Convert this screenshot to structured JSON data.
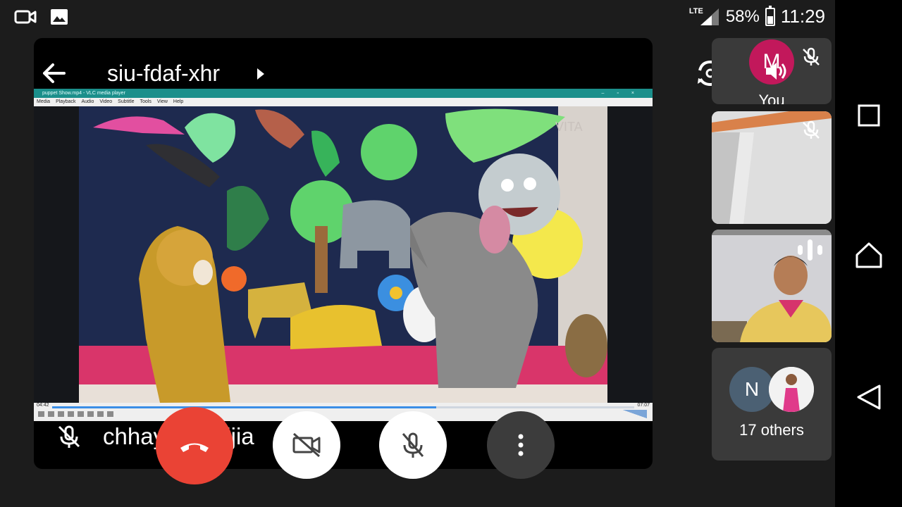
{
  "status_bar": {
    "network": "LTE",
    "battery_percent": "58%",
    "battery_level": 0.58,
    "time": "11:29"
  },
  "meeting": {
    "code": "siu-fdaf-xhr"
  },
  "vlc": {
    "window_title": "puppet Show.mp4 - VLC media player",
    "menu": [
      "Media",
      "Playback",
      "Audio",
      "Video",
      "Subtitle",
      "Tools",
      "View",
      "Help"
    ],
    "elapsed": "04:42",
    "total": "07:07",
    "progress": 0.66,
    "video_watermark": "VITA"
  },
  "presenter": {
    "name": "chhaya Sindjia"
  },
  "participants": {
    "self_initial": "M",
    "self_label": "You",
    "others_initial": "N",
    "others_count_label": "17 others"
  },
  "colors": {
    "end_call": "#ea4335",
    "self_avatar": "#c2185b",
    "others_avatar": "#4b6073",
    "vlc_title": "#1b8f8b"
  }
}
